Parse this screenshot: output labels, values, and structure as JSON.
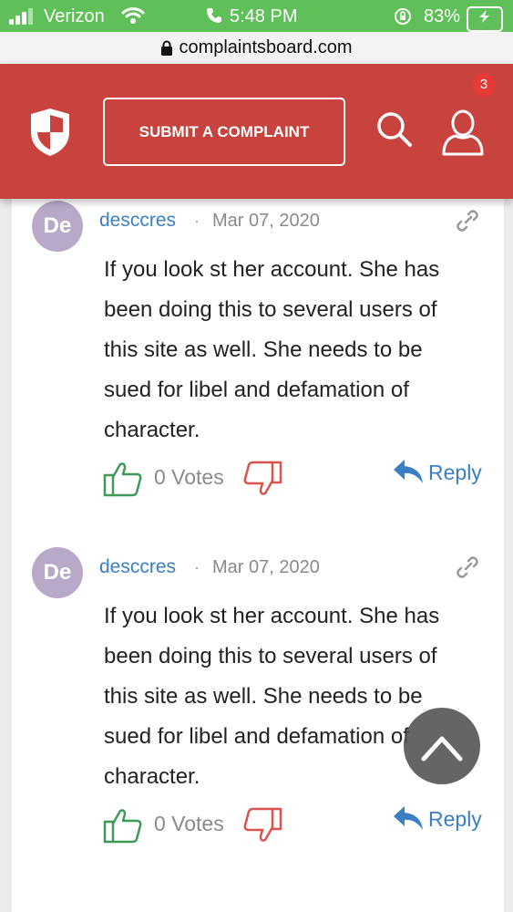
{
  "status_bar": {
    "carrier": "Verizon",
    "time": "5:48 PM",
    "battery": "83%"
  },
  "url_bar": {
    "domain": "complaintsboard.com"
  },
  "header": {
    "submit_label": "SUBMIT A COMPLAINT",
    "notification_count": "3",
    "logo": "shield-logo",
    "search_icon": "search-icon",
    "user_icon": "user-icon",
    "colors": {
      "brand": "#c8433e",
      "accent": "#3a7fc4",
      "upvote": "#3f9a5a",
      "downvote": "#d9534f"
    }
  },
  "comments": [
    {
      "avatar_initials": "De",
      "author": "desccres",
      "separator": "·",
      "date": "Mar 07, 2020",
      "text_lines": [
        "If you look st her account. She has",
        "been doing this to several users of",
        "this site as well. She needs to be",
        "sued for libel and defamation of",
        "character."
      ],
      "votes": "0 Votes",
      "reply_label": "Reply"
    },
    {
      "avatar_initials": "De",
      "author": "desccres",
      "separator": "·",
      "date": "Mar 07, 2020",
      "text_lines": [
        "If you look st her account. She has",
        "been doing this to several users of",
        "this site as well. She needs to be",
        "sued for libel and defamation of",
        "character."
      ],
      "votes": "0 Votes",
      "reply_label": "Reply"
    }
  ]
}
